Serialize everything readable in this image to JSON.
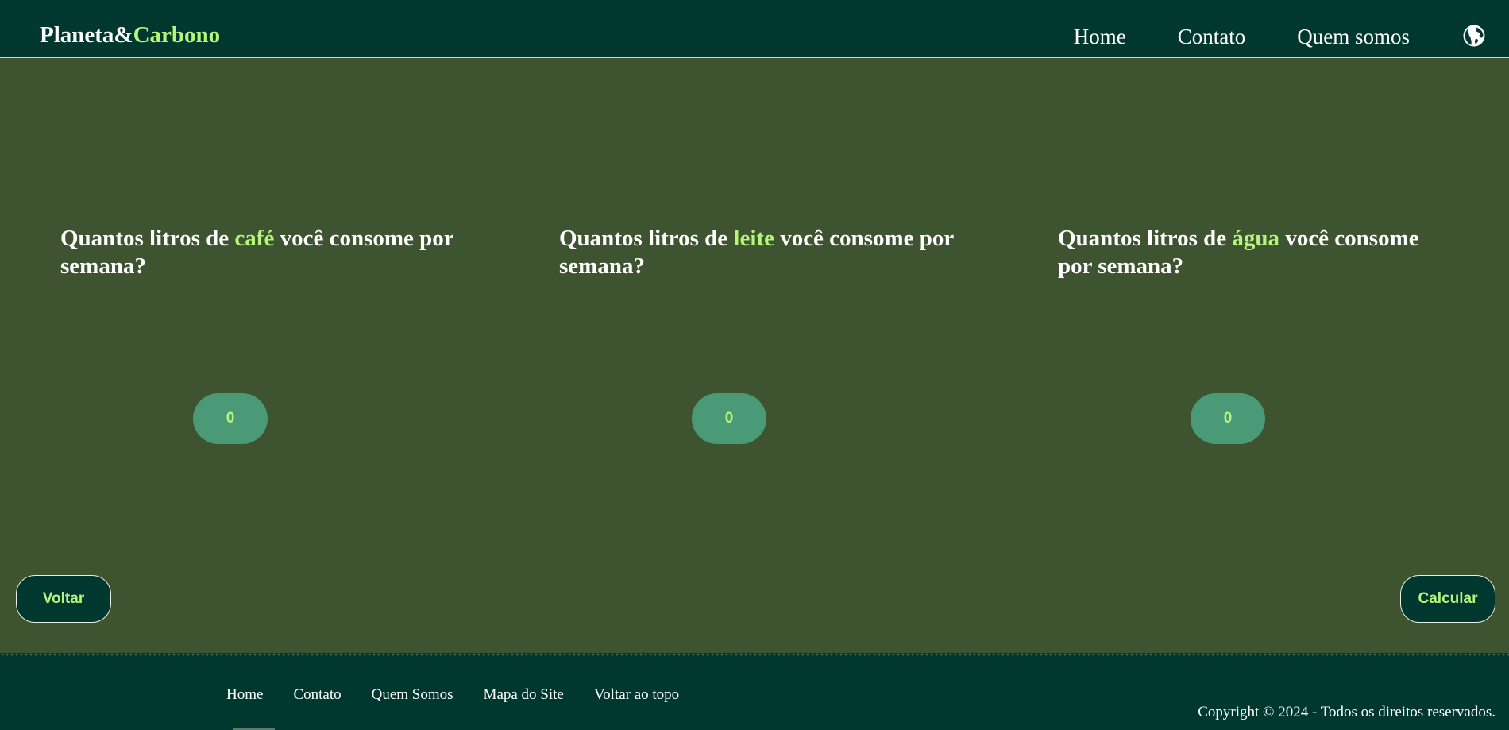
{
  "header": {
    "brand_part1": "Planeta&",
    "brand_part2": "Carbono",
    "nav": [
      "Home",
      "Contato",
      "Quem somos"
    ],
    "language_icon": "globe-icon"
  },
  "questions": [
    {
      "prefix": "Quantos litros de ",
      "highlight": "café",
      "suffix": " você consome por semana?",
      "value": "0"
    },
    {
      "prefix": "Quantos litros de ",
      "highlight": "leite",
      "suffix": " você consome por semana?",
      "value": "0"
    },
    {
      "prefix": "Quantos litros de ",
      "highlight": "água",
      "suffix": " você consome por semana?",
      "value": "0"
    }
  ],
  "buttons": {
    "back": "Voltar",
    "calculate": "Calcular"
  },
  "footer": {
    "links": [
      "Home",
      "Contato",
      "Quem Somos",
      "Mapa do Site",
      "Voltar ao topo"
    ],
    "copyright": "Copyright © 2024 - Todos os direitos reservados."
  },
  "colors": {
    "header_bg": "#003830",
    "main_bg": "#3e5330",
    "accent": "#b6f57a",
    "input_bg": "#4a9a78"
  }
}
